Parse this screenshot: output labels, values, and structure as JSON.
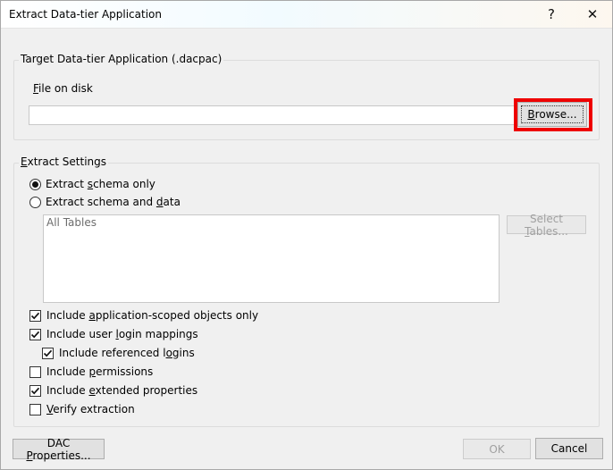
{
  "window": {
    "title": "Extract Data-tier Application",
    "help_glyph": "?",
    "close_glyph": "✕"
  },
  "target_group": {
    "title": "Target Data-tier Application (.dacpac)",
    "file_label": {
      "pre": "",
      "key": "F",
      "post": "ile on disk"
    },
    "file_value": "",
    "browse_button": {
      "pre": "",
      "key": "B",
      "post": "rowse..."
    }
  },
  "extract_group": {
    "title": {
      "pre": "",
      "key": "E",
      "post": "xtract Settings"
    },
    "radio_schema": {
      "pre": "Extract ",
      "key": "s",
      "post": "chema only",
      "checked": true
    },
    "radio_schema_data": {
      "pre": "Extract schema and ",
      "key": "d",
      "post": "ata",
      "checked": false
    },
    "tables_list_placeholder": "All Tables",
    "select_tables_button": {
      "pre": "Select ",
      "key": "T",
      "post": "ables...",
      "enabled": false
    },
    "checkboxes": [
      {
        "pre": "Include ",
        "key": "a",
        "post": "pplication-scoped objects only",
        "checked": true
      },
      {
        "pre": "Include user ",
        "key": "l",
        "post": "ogin mappings",
        "checked": true
      },
      {
        "pre": "Include referenced l",
        "key": "o",
        "post": "gins",
        "checked": true
      },
      {
        "pre": "Include ",
        "key": "p",
        "post": "ermissions",
        "checked": false
      },
      {
        "pre": "Include ",
        "key": "e",
        "post": "xtended properties",
        "checked": true
      },
      {
        "pre": "",
        "key": "V",
        "post": "erify extraction",
        "checked": false
      }
    ]
  },
  "footer": {
    "dac_properties_button": {
      "pre": "DAC ",
      "key": "P",
      "post": "roperties..."
    },
    "ok_button": "OK",
    "cancel_button": "Cancel"
  }
}
